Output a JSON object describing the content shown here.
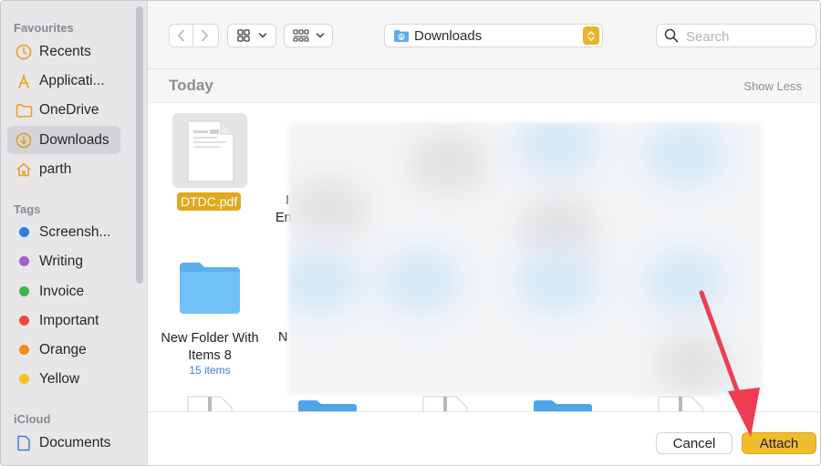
{
  "sidebar": {
    "favourites_header": "Favourites",
    "favourites": [
      {
        "label": "Recents",
        "icon": "clock-icon"
      },
      {
        "label": "Applicati...",
        "icon": "applications-icon"
      },
      {
        "label": "OneDrive",
        "icon": "folder-icon"
      },
      {
        "label": "Downloads",
        "icon": "downloads-icon",
        "selected": true
      },
      {
        "label": "parth",
        "icon": "home-icon"
      }
    ],
    "tags_header": "Tags",
    "tags": [
      {
        "label": "Screensh...",
        "color": "#2f7fe0"
      },
      {
        "label": "Writing",
        "color": "#a35fd0"
      },
      {
        "label": "Invoice",
        "color": "#3fb649"
      },
      {
        "label": "Important",
        "color": "#ec4a3a"
      },
      {
        "label": "Orange",
        "color": "#f08c1d"
      },
      {
        "label": "Yellow",
        "color": "#f3c319"
      }
    ],
    "icloud_header": "iCloud",
    "icloud": [
      {
        "label": "Documents",
        "icon": "document-icon"
      }
    ]
  },
  "toolbar": {
    "location": "Downloads",
    "search_placeholder": "Search"
  },
  "content": {
    "section_title": "Today",
    "show_less": "Show Less",
    "selected_file": "DTDC.pdf",
    "folder_name": "New Folder With Items 8",
    "folder_items": "15 items",
    "partial_text_1": "I",
    "partial_text_2": "En",
    "partial_text_3": "N"
  },
  "footer": {
    "cancel_label": "Cancel",
    "attach_label": "Attach"
  },
  "colors": {
    "accent": "#f0bd2d",
    "annotation_arrow": "#ee3d50"
  }
}
